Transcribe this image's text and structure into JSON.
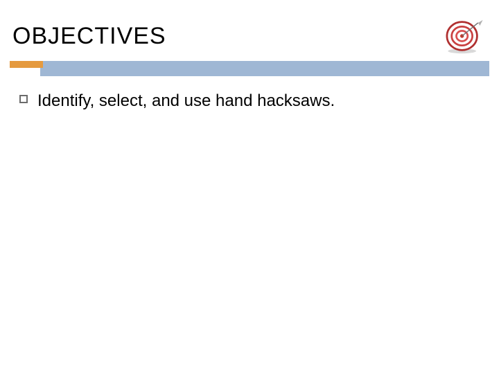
{
  "title": "OBJECTIVES",
  "bullets": [
    {
      "text": "Identify, select, and use hand hacksaws."
    }
  ],
  "colors": {
    "accent_blue": "#9fb7d4",
    "accent_orange": "#e59a3f",
    "target_red": "#c0392b"
  },
  "icon": {
    "name": "target-icon"
  }
}
